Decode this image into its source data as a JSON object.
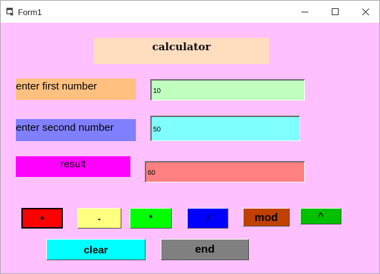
{
  "window": {
    "title": "Form1",
    "background": "#ffc0ff",
    "controls": [
      "minimize-icon",
      "maximize-icon",
      "close-icon"
    ]
  },
  "heading": {
    "text": "calculator",
    "background": "#ffdec0"
  },
  "labels": {
    "first": {
      "text": "enter first number",
      "background": "#ffc080"
    },
    "second": {
      "text": "enter second number",
      "background": "#8080ff"
    },
    "result": {
      "text": "result",
      "background": "#ff00ff"
    }
  },
  "fields": {
    "first": {
      "value": "10",
      "background": "#c0ffc0"
    },
    "second": {
      "value": "50",
      "background": "#80ffff"
    },
    "result": {
      "value": "60",
      "background": "#ff8080"
    }
  },
  "buttons": {
    "plus": {
      "label": "+",
      "background": "#ff0000"
    },
    "minus": {
      "label": "-",
      "background": "#ffff80"
    },
    "multiply": {
      "label": "*",
      "background": "#00ff00"
    },
    "divide": {
      "label": "/",
      "background": "#0000ff"
    },
    "mod": {
      "label": "mod",
      "background": "#c04000"
    },
    "power": {
      "label": "^",
      "background": "#00c000"
    },
    "clear": {
      "label": "clear",
      "background": "#00ffff"
    },
    "end": {
      "label": "end",
      "background": "#808080"
    }
  }
}
